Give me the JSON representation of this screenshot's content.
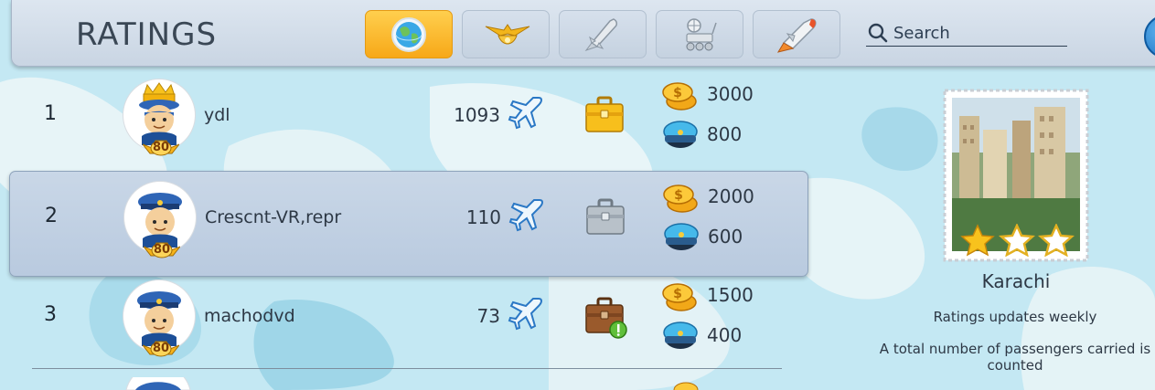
{
  "header": {
    "title": "RATINGS",
    "tabs": [
      {
        "icon": "globe-icon",
        "active": true
      },
      {
        "icon": "wings-badge-icon",
        "active": false
      },
      {
        "icon": "rocket-icon",
        "active": false
      },
      {
        "icon": "rover-icon",
        "active": false
      },
      {
        "icon": "shuttle-icon",
        "active": false
      }
    ],
    "search_placeholder": "Search"
  },
  "rows": [
    {
      "rank": "1",
      "name": "ydl",
      "level": "80",
      "planes": "1093",
      "coins": "3000",
      "hats": "800",
      "case": "gold",
      "highlight": false
    },
    {
      "rank": "2",
      "name": "Crescnt-VR,repr",
      "level": "80",
      "planes": "110",
      "coins": "2000",
      "hats": "600",
      "case": "silver",
      "highlight": true
    },
    {
      "rank": "3",
      "name": "machodvd",
      "level": "80",
      "planes": "73",
      "coins": "1500",
      "hats": "400",
      "case": "brown",
      "highlight": false
    }
  ],
  "panel": {
    "city": "Karachi",
    "stars": 1,
    "weekly_note": "Ratings updates weekly",
    "total_note": "A total number of passengers carried is counted"
  },
  "colors": {
    "active_tab": "#f7a818",
    "map_water": "#c4e8f3",
    "map_land": "#e9f5f8"
  }
}
